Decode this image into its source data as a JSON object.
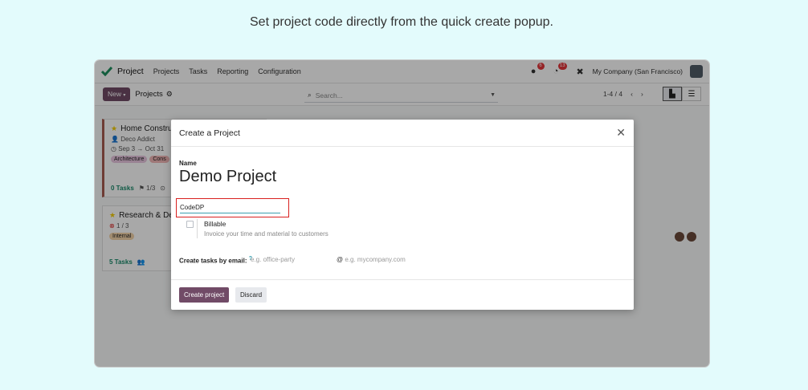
{
  "caption": "Set project code directly from the quick create popup.",
  "topbar": {
    "app_name": "Project",
    "menu": [
      "Projects",
      "Tasks",
      "Reporting",
      "Configuration"
    ],
    "chat_badge": "6",
    "activity_badge": "13",
    "company": "My Company (San Francisco)"
  },
  "controlbar": {
    "new_label": "New",
    "breadcrumb": "Projects",
    "search_placeholder": "Search...",
    "pager": "1-4 / 4"
  },
  "kanban": {
    "cards": [
      {
        "title": "Home Constru",
        "customer": "Deco Addict",
        "date_start": "Sep 3",
        "date_end": "Oct 31",
        "tags": [
          "Architecture",
          "Cons"
        ],
        "tasks": "0 Tasks",
        "milestones": "1/3"
      },
      {
        "title": "Research & De",
        "milestones": "1 / 3",
        "tags": [
          "Internal"
        ],
        "tasks": "5 Tasks"
      }
    ]
  },
  "dialog": {
    "title": "Create a Project",
    "name_label": "Name",
    "name_value": "Demo Project",
    "code_value": "CodeDP",
    "billable_label": "Billable",
    "billable_desc": "Invoice your time and material to customers",
    "email_label": "Create tasks by email:",
    "alias_placeholder": "e.g. office-party",
    "domain_placeholder": "e.g. mycompany.com",
    "create_label": "Create project",
    "discard_label": "Discard"
  },
  "colors": {
    "brand": "#714b67",
    "highlight_border": "#d9201f",
    "badge": "#e2363a",
    "background": "#e3fbfc"
  }
}
